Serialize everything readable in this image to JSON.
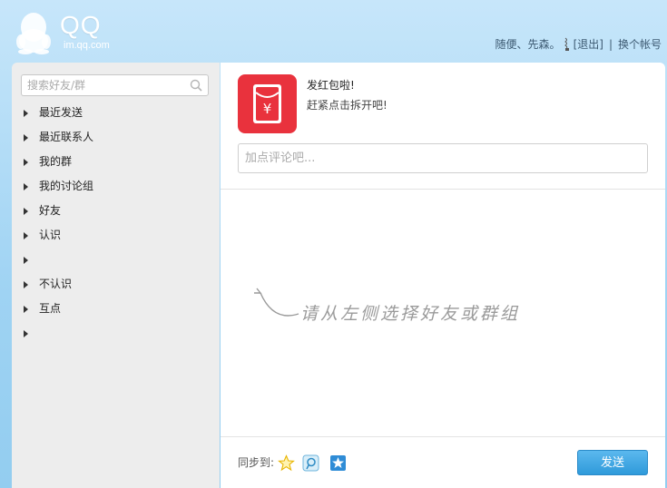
{
  "header": {
    "logo_text": "QQ",
    "logo_sub": "im.qq.com",
    "username": "随便、先森。",
    "logout_label": "[退出]",
    "separator": "|",
    "switch_account_label": "换个帐号"
  },
  "search": {
    "placeholder": "搜索好友/群"
  },
  "tree": {
    "items": [
      {
        "label": "最近发送"
      },
      {
        "label": "最近联系人"
      },
      {
        "label": "我的群"
      },
      {
        "label": "我的讨论组"
      },
      {
        "label": "好友"
      },
      {
        "label": "认识"
      },
      {
        "label": ""
      },
      {
        "label": "不认识"
      },
      {
        "label": "互点"
      },
      {
        "label": ""
      }
    ]
  },
  "share": {
    "icon": "red-packet-icon",
    "title": "发红包啦!",
    "subtitle": "赶紧点击拆开吧!",
    "comment_placeholder": "加点评论吧..."
  },
  "hint": {
    "text": "请从左侧选择好友或群组"
  },
  "footer": {
    "sync_label": "同步到:",
    "sync_targets": [
      "qzone-star-icon",
      "tencent-weibo-icon",
      "favorites-star-icon"
    ],
    "send_label": "发送"
  },
  "colors": {
    "background": "#9fd3f3",
    "red_packet": "#e9323d",
    "send_button": "#2f9ada"
  }
}
